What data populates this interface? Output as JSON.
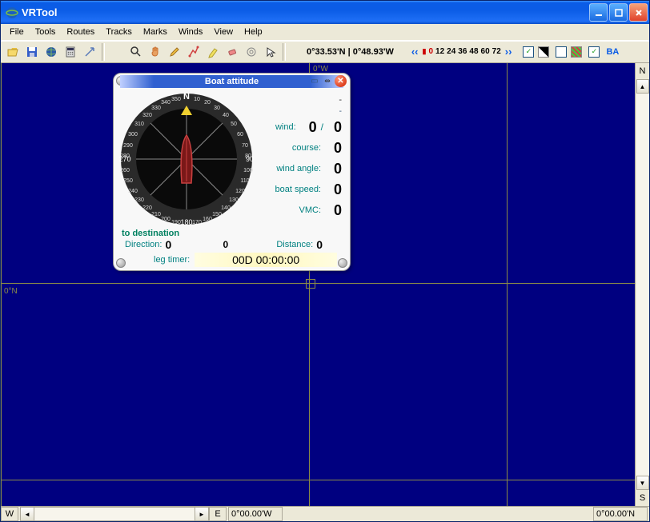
{
  "title": "VRTool",
  "menu": {
    "file": "File",
    "tools": "Tools",
    "routes": "Routes",
    "tracks": "Tracks",
    "marks": "Marks",
    "winds": "Winds",
    "view": "View",
    "help": "Help"
  },
  "coords": "0°33.53'N | 0°48.93'W",
  "timescale": {
    "t0": "0",
    "t12": "12",
    "t24": "24",
    "t36": "36",
    "t48": "48",
    "t60": "60",
    "t72": "72"
  },
  "ba": "BA",
  "map": {
    "lon_label": "0°W",
    "lat_label": "0°N"
  },
  "scroll": {
    "n": "N",
    "s": "S",
    "w": "W",
    "e": "E"
  },
  "status": {
    "lon": "0°00.00'W",
    "lat": "0°00.00'N"
  },
  "panel": {
    "title": "Boat attitude",
    "dash": "-",
    "wind_label": "wind:",
    "wind_a": "0",
    "wind_sep": "/",
    "wind_b": "0",
    "course_label": "course:",
    "course_val": "0",
    "windangle_label": "wind angle:",
    "windangle_val": "0",
    "boatspeed_label": "boat speed:",
    "boatspeed_val": "0",
    "vmc_label": "VMC:",
    "vmc_val": "0",
    "dest": "to destination",
    "dir_label": "Direction:",
    "dir_val": "0",
    "dir_mid": "0",
    "dist_label": "Distance:",
    "dist_val": "0",
    "leg_label": "leg timer:",
    "leg_val": "00D 00:00:00"
  }
}
